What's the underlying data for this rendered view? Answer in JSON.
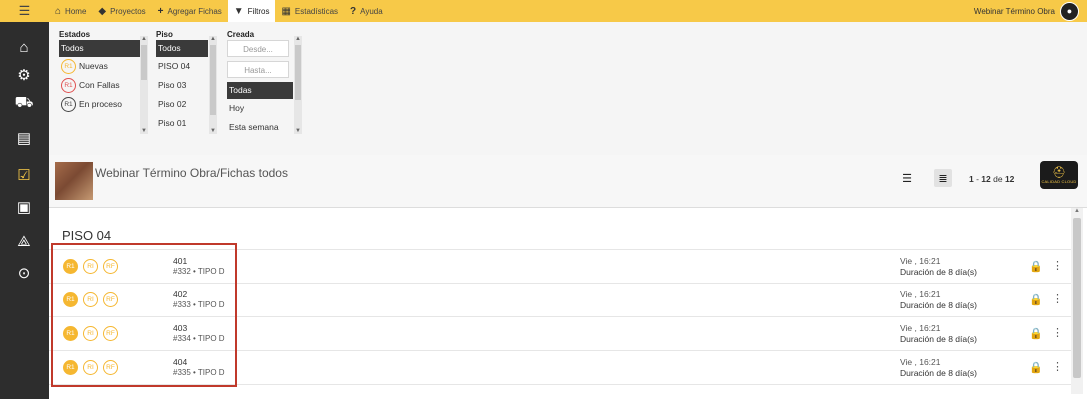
{
  "topbar": {
    "nav": [
      {
        "icon": "home-icon",
        "glyph": "🏠",
        "label": "Home"
      },
      {
        "icon": "tag-icon",
        "glyph": "🏷",
        "label": "Proyectos"
      },
      {
        "icon": "plus-icon",
        "glyph": "✚",
        "label": "Agregar Fichas"
      },
      {
        "icon": "filter-icon",
        "glyph": "▼",
        "label": "Filtros"
      },
      {
        "icon": "chart-icon",
        "glyph": "▦",
        "label": "Estadísticas"
      },
      {
        "icon": "help-icon",
        "glyph": "?",
        "label": "Ayuda"
      }
    ],
    "user_name": "Webinar Término Obra"
  },
  "filters": {
    "estados": {
      "title": "Estados",
      "selected": "Todos",
      "options": [
        "Nuevas",
        "Con Fallas",
        "En proceso"
      ]
    },
    "piso": {
      "title": "Piso",
      "selected": "Todos",
      "options": [
        "PISO 04",
        "Piso 03",
        "Piso 02",
        "Piso 01"
      ]
    },
    "creada": {
      "title": "Creada",
      "desde_placeholder": "Desde...",
      "hasta_placeholder": "Hasta...",
      "selected": "Todas",
      "options": [
        "Hoy",
        "Esta semana"
      ]
    }
  },
  "header": {
    "title": "Webinar Término Obra/Fichas todos",
    "pager_start": "1",
    "pager_sep": " - ",
    "pager_end": "12",
    "pager_of": " de ",
    "pager_total": "12",
    "logo_text": "CALIDAD CLOUD"
  },
  "section": {
    "title": "PISO 04"
  },
  "badge_labels": {
    "r1": "R1",
    "ri": "RI",
    "rf": "RF"
  },
  "rows": [
    {
      "num": "401",
      "sub": "#332 • TIPO D",
      "date": "Vie , 16:21",
      "duration": "Duración de 8 día(s)"
    },
    {
      "num": "402",
      "sub": "#333 • TIPO D",
      "date": "Vie , 16:21",
      "duration": "Duración de 8 día(s)"
    },
    {
      "num": "403",
      "sub": "#334 • TIPO D",
      "date": "Vie , 16:21",
      "duration": "Duración de 8 día(s)"
    },
    {
      "num": "404",
      "sub": "#335 • TIPO D",
      "date": "Vie , 16:21",
      "duration": "Duración de 8 día(s)"
    }
  ],
  "colors": {
    "accent": "#f7c948",
    "sidebar": "#2d2d2d",
    "badge": "#f5b731",
    "highlight_box": "#c0392b"
  }
}
